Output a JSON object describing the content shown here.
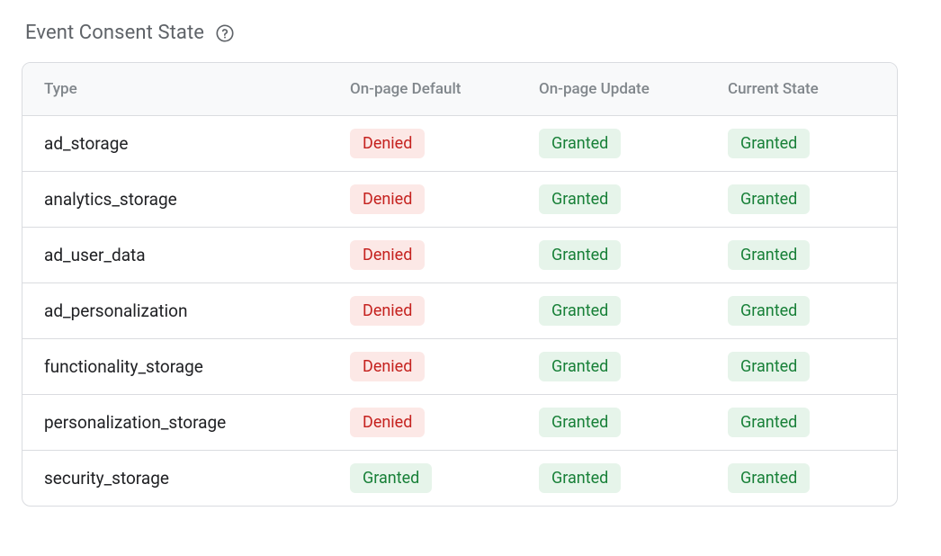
{
  "section": {
    "title": "Event Consent State",
    "help_icon": "help-circle-icon"
  },
  "columns": {
    "type": "Type",
    "default": "On-page Default",
    "update": "On-page Update",
    "current": "Current State"
  },
  "status_labels": {
    "denied": "Denied",
    "granted": "Granted"
  },
  "rows": [
    {
      "type": "ad_storage",
      "default": "denied",
      "update": "granted",
      "current": "granted"
    },
    {
      "type": "analytics_storage",
      "default": "denied",
      "update": "granted",
      "current": "granted"
    },
    {
      "type": "ad_user_data",
      "default": "denied",
      "update": "granted",
      "current": "granted"
    },
    {
      "type": "ad_personalization",
      "default": "denied",
      "update": "granted",
      "current": "granted"
    },
    {
      "type": "functionality_storage",
      "default": "denied",
      "update": "granted",
      "current": "granted"
    },
    {
      "type": "personalization_storage",
      "default": "denied",
      "update": "granted",
      "current": "granted"
    },
    {
      "type": "security_storage",
      "default": "granted",
      "update": "granted",
      "current": "granted"
    }
  ]
}
